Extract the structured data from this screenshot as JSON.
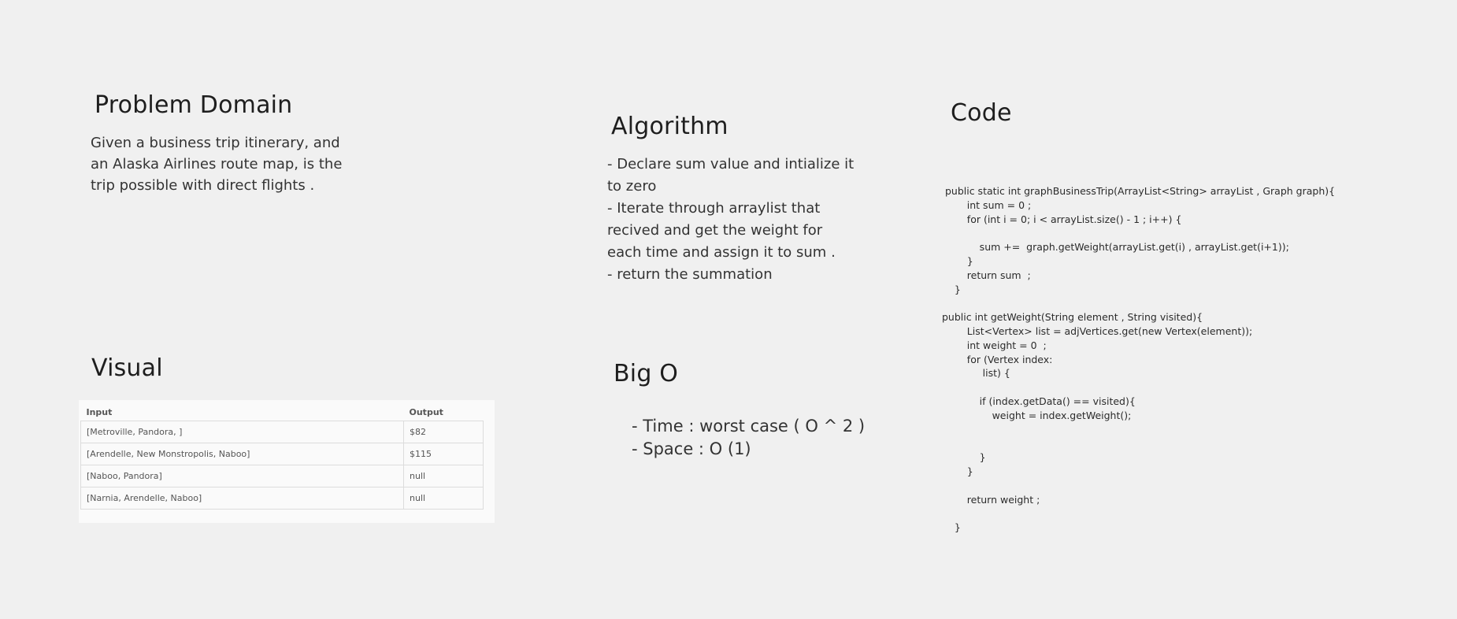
{
  "problem_domain": {
    "title": "Problem Domain",
    "lines": [
      "Given a business trip itinerary, and",
      "an Alaska Airlines route map, is the",
      "trip possible with direct flights ."
    ]
  },
  "algorithm": {
    "title": "Algorithm",
    "lines": [
      "- Declare sum value and intialize it",
      "to zero",
      "- Iterate through arraylist that",
      "recived and get the weight for",
      "each time and assign it to sum .",
      "- return the summation"
    ]
  },
  "code": {
    "title": "Code",
    "lines": [
      " public static int graphBusinessTrip(ArrayList<String> arrayList , Graph graph){",
      "        int sum = 0 ;",
      "        for (int i = 0; i < arrayList.size() - 1 ; i++) {",
      "",
      "            sum +=  graph.getWeight(arrayList.get(i) , arrayList.get(i+1));",
      "        }",
      "        return sum  ;",
      "    }",
      "",
      "public int getWeight(String element , String visited){",
      "        List<Vertex> list = adjVertices.get(new Vertex(element));",
      "        int weight = 0  ;",
      "        for (Vertex index:",
      "             list) {",
      "",
      "            if (index.getData() == visited){",
      "                weight = index.getWeight();",
      "",
      "",
      "            }",
      "        }",
      "",
      "        return weight ;",
      "",
      "    }"
    ]
  },
  "visual": {
    "title": "Visual",
    "table": {
      "headers": [
        "Input",
        "Output"
      ],
      "rows": [
        [
          "[Metroville, Pandora, ]",
          "$82"
        ],
        [
          "[Arendelle, New Monstropolis, Naboo]",
          "$115"
        ],
        [
          "[Naboo, Pandora]",
          "null"
        ],
        [
          "[Narnia, Arendelle, Naboo]",
          "null"
        ]
      ]
    }
  },
  "big_o": {
    "title": "Big O",
    "lines": [
      "- Time : worst case ( O ^ 2 )",
      "- Space : O (1)"
    ]
  }
}
